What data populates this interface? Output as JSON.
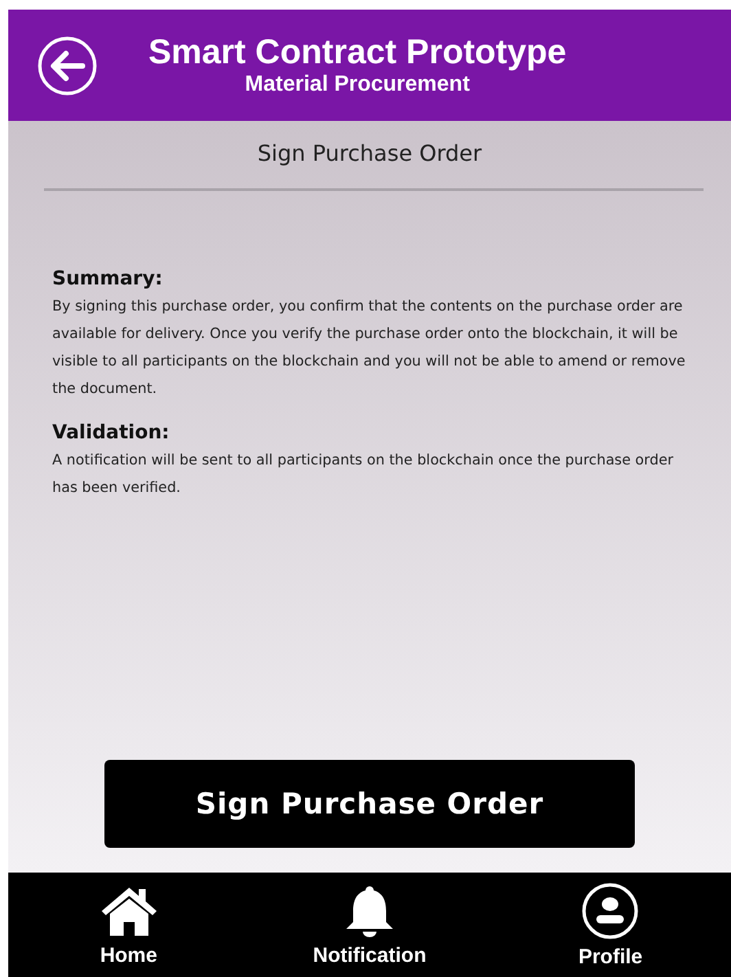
{
  "header": {
    "title": "Smart Contract Prototype",
    "subtitle": "Material Procurement"
  },
  "page_title": "Sign Purchase Order",
  "sections": [
    {
      "heading": "Summary:",
      "body": "By signing this purchase order, you confirm that the contents on the purchase order are available for delivery. Once you verify the purchase order onto the blockchain, it will be visible to all participants on the blockchain and you will not be able to amend or remove the document."
    },
    {
      "heading": "Validation:",
      "body": "A notification will be sent to all participants on the blockchain once the purchase order has been verified."
    }
  ],
  "action_button": "Sign Purchase Order",
  "nav": [
    {
      "label": "Home"
    },
    {
      "label": "Notification"
    },
    {
      "label": "Profile"
    }
  ]
}
